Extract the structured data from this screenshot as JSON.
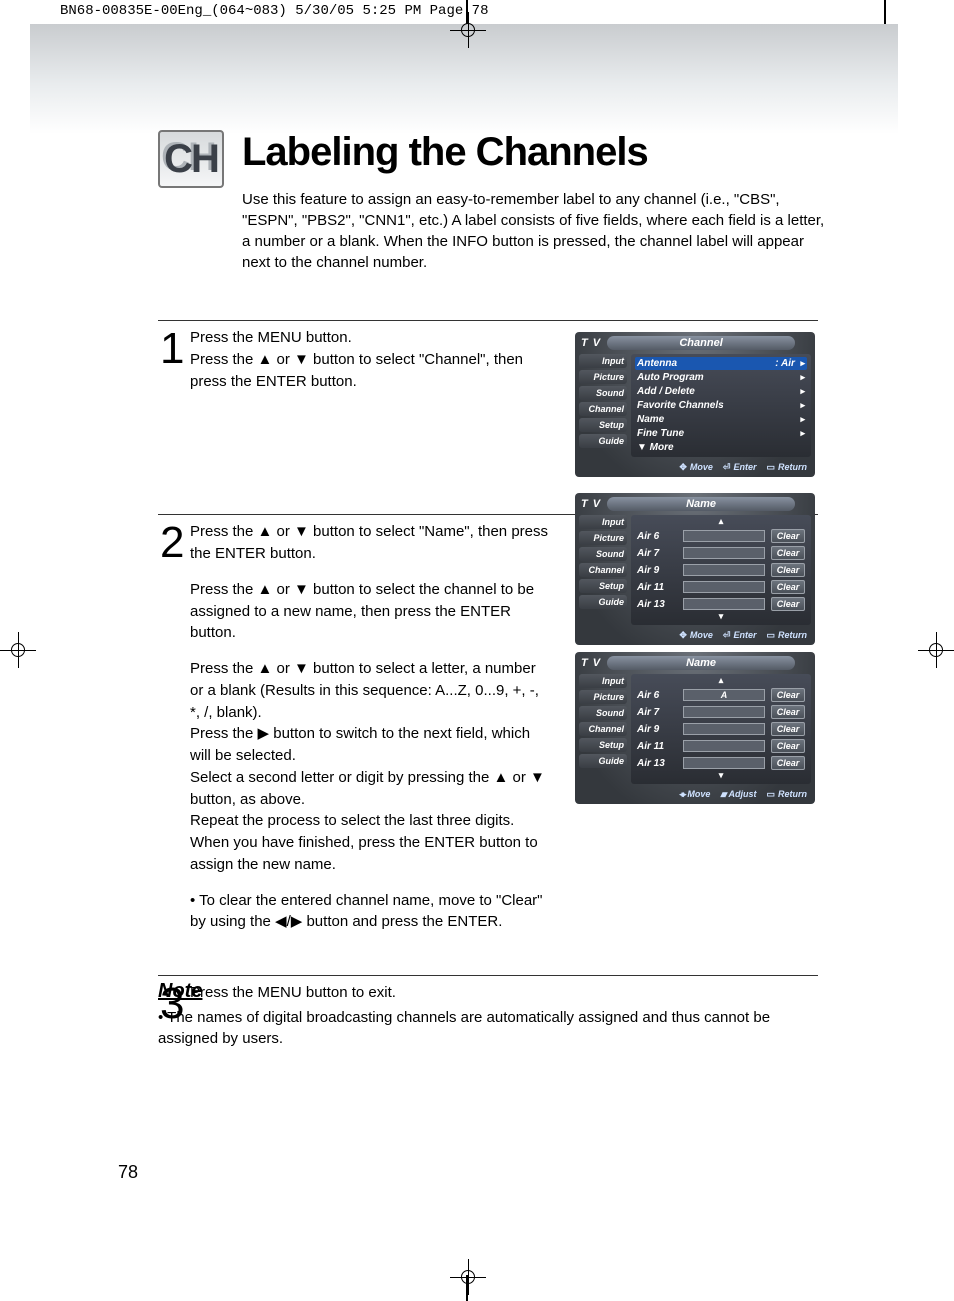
{
  "meta_strip": "BN68-00835E-00Eng_(064~083)  5/30/05  5:25 PM  Page 78",
  "badge": "CH",
  "title": "Labeling the Channels",
  "intro": "Use this feature to assign an easy-to-remember label to any channel (i.e., \"CBS\", \"ESPN\", \"PBS2\", \"CNN1\", etc.) A label consists of five fields, where each field is a letter, a number or a blank. When the INFO button is pressed, the channel label will appear next to the channel number.",
  "steps": {
    "s1": {
      "num": "1",
      "p1": "Press the MENU button.",
      "p2": "Press the ▲ or ▼ button to select \"Channel\", then press the ENTER button."
    },
    "s2": {
      "num": "2",
      "p1": "Press the ▲ or ▼ button to select \"Name\", then press the ENTER button.",
      "p2": "Press the ▲ or ▼ button to select the channel to be assigned to a new name, then press the ENTER button.",
      "p3": "Press the ▲ or ▼ button to select a letter, a number or a blank (Results in this sequence: A...Z, 0...9, +, -, *, /, blank).",
      "p4": "Press the ▶ button to switch to the next field, which will be selected.",
      "p5": "Select a second letter or digit by pressing the ▲ or ▼ button, as above.",
      "p6": "Repeat the process to select the last three digits. When you have finished, press the ENTER button to assign the new name.",
      "bullet": "To clear the entered channel name, move to \"Clear\" by using the ◀/▶ button and press the ENTER."
    },
    "s3": {
      "num": "3",
      "p1": "Press the MENU button to exit."
    }
  },
  "note": {
    "head": "Note",
    "body": "The names of digital broadcasting channels are automatically assigned and thus cannot be assigned by users."
  },
  "page_number": "78",
  "osd": {
    "tv": "T V",
    "side": [
      "Input",
      "Picture",
      "Sound",
      "Channel",
      "Setup",
      "Guide"
    ],
    "clear": "Clear",
    "foot": {
      "move": "Move",
      "enter": "Enter",
      "return": "Return",
      "adjust": "Adjust"
    },
    "screen1": {
      "title": "Channel",
      "rows": [
        {
          "l": "Antenna",
          "r": ": Air",
          "sel": true,
          "a": true
        },
        {
          "l": "Auto Program",
          "r": "",
          "a": true
        },
        {
          "l": "Add / Delete",
          "r": "",
          "a": true
        },
        {
          "l": "Favorite Channels",
          "r": "",
          "a": true
        },
        {
          "l": "Name",
          "r": "",
          "a": true
        },
        {
          "l": "Fine Tune",
          "r": "",
          "a": true
        },
        {
          "l": "▼ More",
          "r": "",
          "a": false
        }
      ]
    },
    "screen2": {
      "title": "Name",
      "rows": [
        "Air 6",
        "Air 7",
        "Air 9",
        "Air 11",
        "Air 13"
      ]
    },
    "screen3": {
      "title": "Name",
      "rows": [
        "Air 6",
        "Air 7",
        "Air 9",
        "Air 11",
        "Air 13"
      ],
      "edit_value": "A"
    }
  }
}
